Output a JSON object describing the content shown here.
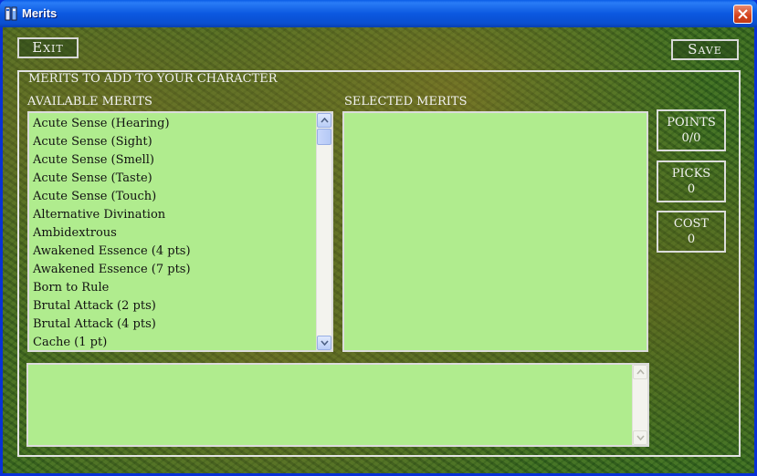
{
  "window": {
    "title": "Merits"
  },
  "toolbar": {
    "exit_label": "Exit",
    "save_label": "Save"
  },
  "section": {
    "title": "MERITS TO ADD TO YOUR CHARACTER"
  },
  "available": {
    "header": "AVAILABLE MERITS",
    "items": [
      "Acute Sense (Hearing)",
      "Acute Sense (Sight)",
      "Acute Sense (Smell)",
      "Acute Sense (Taste)",
      "Acute Sense (Touch)",
      "Alternative Divination",
      "Ambidextrous",
      "Awakened Essence (4 pts)",
      "Awakened Essence (7 pts)",
      "Born to Rule",
      "Brutal Attack (2 pts)",
      "Brutal Attack (4 pts)",
      "Cache (1 pt)"
    ]
  },
  "selected": {
    "header": "SELECTED MERITS",
    "items": []
  },
  "stats": {
    "points": {
      "label": "POINTS",
      "value": "0/0"
    },
    "picks": {
      "label": "PICKS",
      "value": "0"
    },
    "cost": {
      "label": "COST",
      "value": "0"
    }
  },
  "description": {
    "text": ""
  },
  "colors": {
    "list_bg": "#b0ec8e",
    "titlebar": "#0a5ce6",
    "close": "#d4421c"
  }
}
